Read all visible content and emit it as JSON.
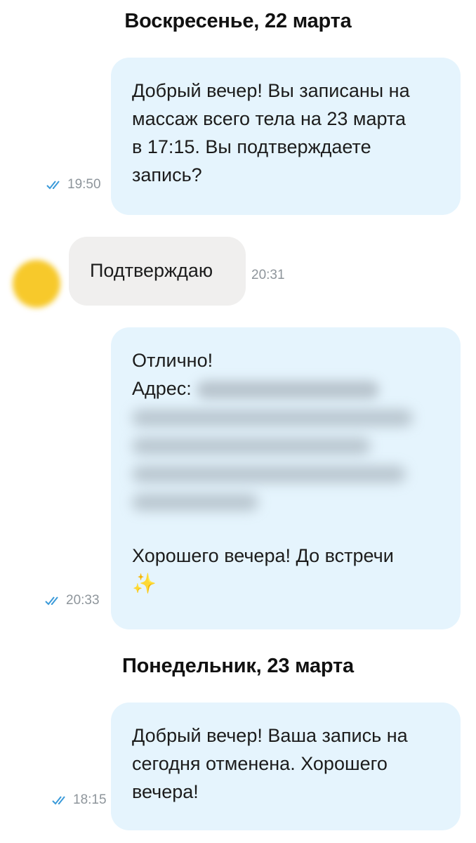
{
  "chat": {
    "day1": {
      "header": "Воскресенье, 22 марта",
      "message1": {
        "lines": [
          "Добрый вечер! Вы записаны на",
          "массаж всего тела на 23 марта",
          "в 17:15. Вы подтверждаете",
          "запись?"
        ],
        "time": "19:50",
        "status": "read"
      },
      "message2": {
        "text": "Подтверждаю",
        "time": "20:31"
      },
      "message3": {
        "line1": "Отлично!",
        "address_label": "Адрес:",
        "closing": "Хорошего вечера! До встречи",
        "emoji": "✨",
        "time": "20:33",
        "status": "read"
      }
    },
    "day2": {
      "header": "Понедельник, 23 марта",
      "message4": {
        "lines": [
          "Добрый вечер! Ваша запись на",
          "сегодня  отменена. Хорошего",
          "вечера!"
        ],
        "time": "18:15",
        "status": "read"
      }
    }
  },
  "colors": {
    "outgoing_bubble": "#e5f4fd",
    "incoming_bubble": "#f0efee",
    "read_check": "#3a9ad9",
    "avatar": "#f7c92b"
  },
  "icons": {
    "read_status": "double-check-icon",
    "avatar": "avatar"
  }
}
